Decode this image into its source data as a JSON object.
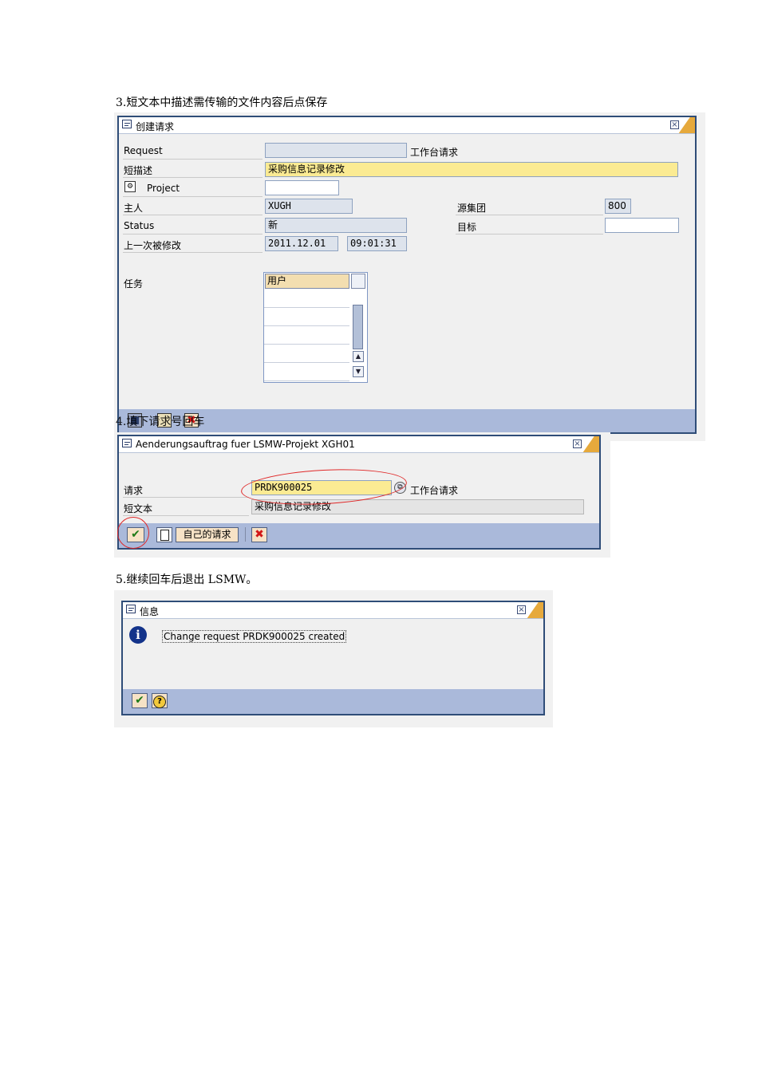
{
  "step3": {
    "heading": "3.短文本中描述需传输的文件内容后点保存",
    "dialog_title": "创建请求",
    "labels": {
      "request": "Request",
      "short_desc": "短描述",
      "project": "Project",
      "owner": "主人",
      "status": "Status",
      "last_changed": "上一次被修改",
      "tasks": "任务",
      "source_client": "源集团",
      "target": "目标"
    },
    "values": {
      "request": "",
      "short_desc": "采购信息记录修改",
      "project": "",
      "owner": "XUGH",
      "status": "新",
      "date": "2011.12.01",
      "time": "09:01:31",
      "source_client": "800",
      "target": ""
    },
    "workbench_label": "工作台请求",
    "tasks_table": {
      "header": "用户"
    }
  },
  "step4": {
    "heading": "4.填下请求号回车",
    "dialog_title": "Aenderungsauftrag fuer LSMW-Projekt XGH01",
    "labels": {
      "request": "请求",
      "short_text": "短文本"
    },
    "values": {
      "request": "PRDK900025",
      "short_text": "采购信息记录修改"
    },
    "workbench_label": "工作台请求",
    "own_requests_button": "自己的请求"
  },
  "step5": {
    "heading": "5.继续回车后退出 LSMW。",
    "dialog_title": "信息",
    "message": "Change request PRDK900025 created"
  },
  "colors": {
    "dialog_border": "#2f4d78",
    "footer": "#aab9da",
    "required_field": "#fbeb93",
    "accent_stripe": "#e6a93c",
    "annotation": "#e02828"
  }
}
